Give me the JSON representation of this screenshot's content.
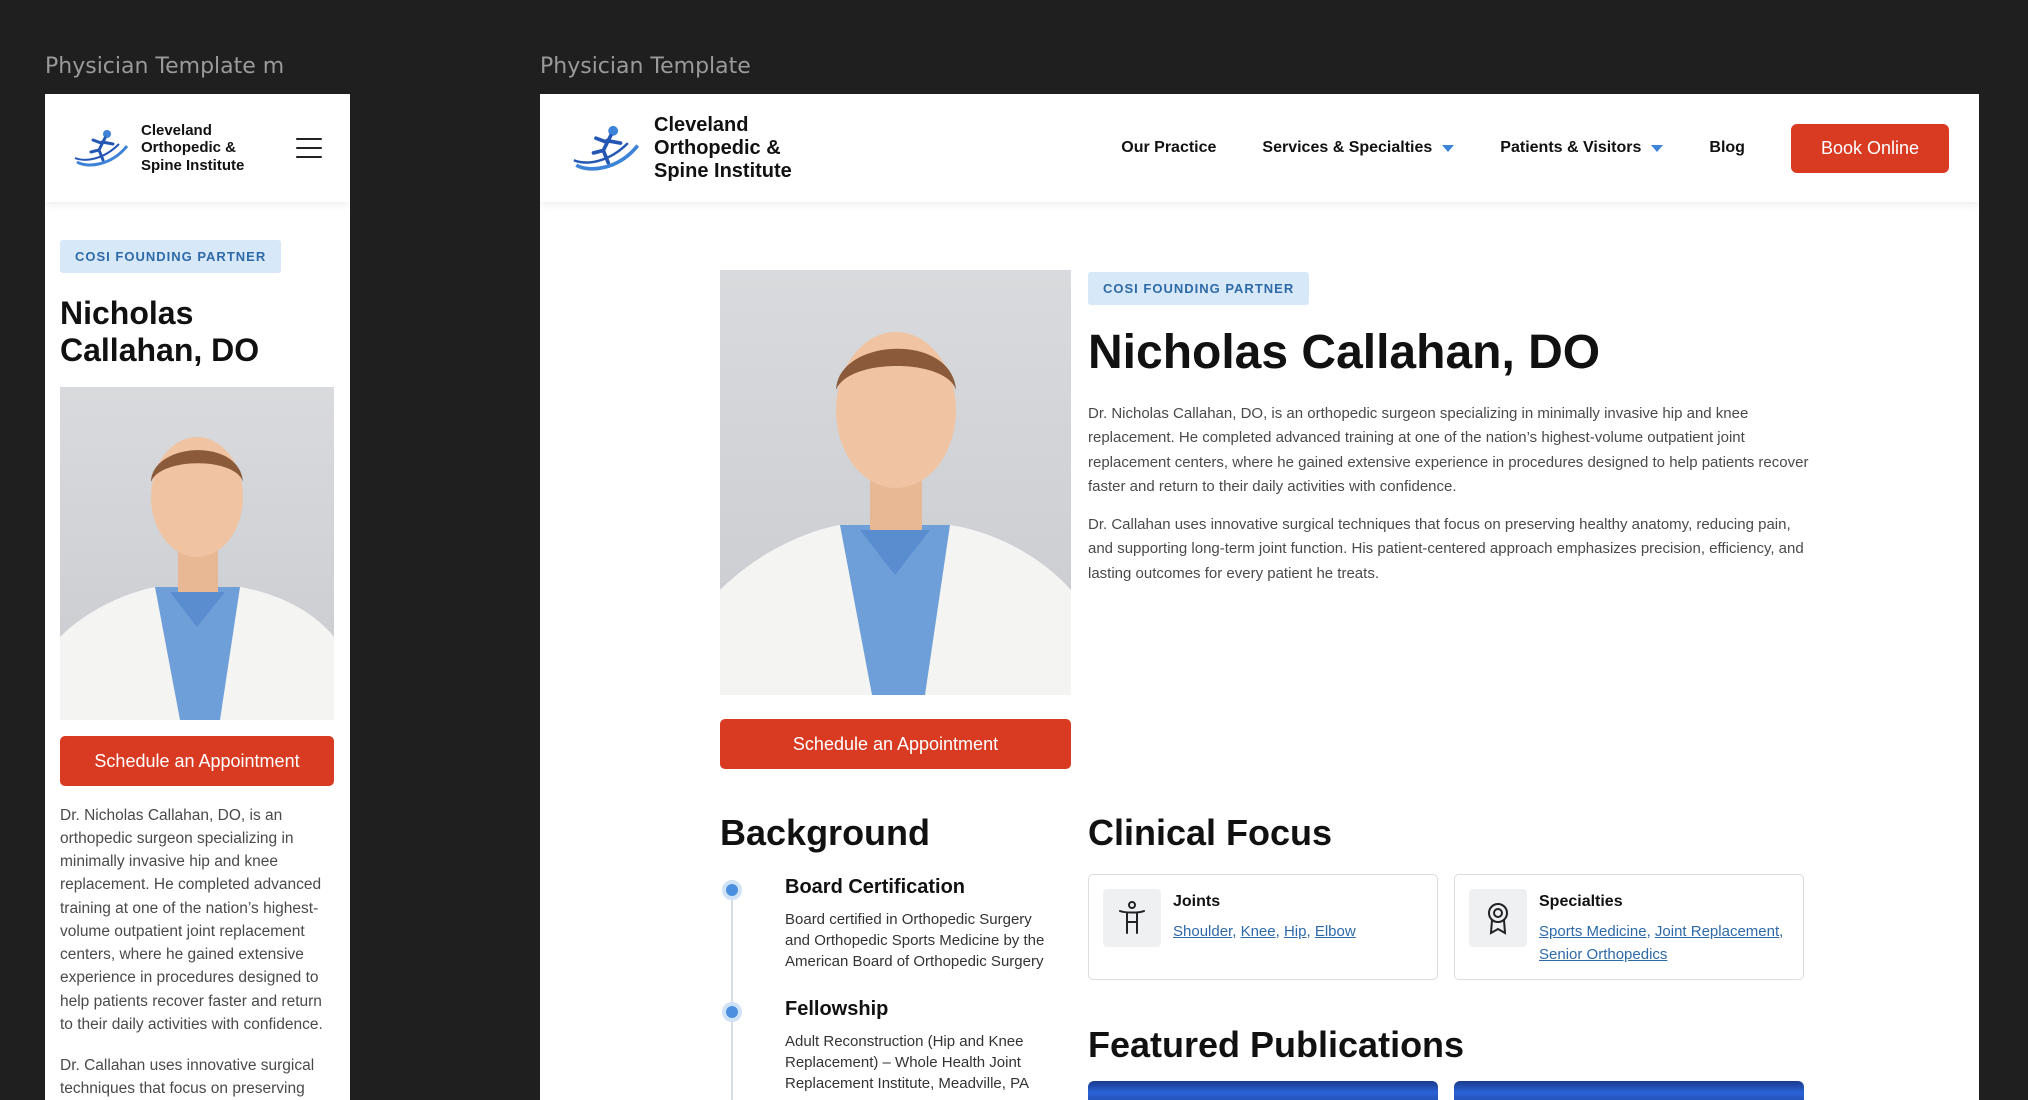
{
  "frames": {
    "mobile_label": "Physician Template m",
    "desktop_label": "Physician Template"
  },
  "brand": {
    "logo_line1": "Cleveland",
    "logo_line2": "Orthopedic &",
    "logo_line3": "Spine Institute",
    "accent_blue": "#3d83d8",
    "accent_red": "#d93a22"
  },
  "nav": {
    "our_practice": "Our Practice",
    "services": "Services & Specialties",
    "patients": "Patients & Visitors",
    "blog": "Blog",
    "book_online": "Book Online"
  },
  "physician": {
    "badge": "COSI FOUNDING PARTNER",
    "name": "Nicholas Callahan, DO",
    "name_line1": "Nicholas",
    "name_line2": "Callahan, DO",
    "schedule_label": "Schedule an Appointment",
    "bio1": "Dr. Nicholas Callahan, DO, is an orthopedic surgeon specializing in minimally invasive hip and knee replacement. He completed advanced training at one of the nation’s highest-volume outpatient joint replacement centers, where he gained extensive experience in procedures designed to help patients recover faster and return to their daily activities with confidence.",
    "bio2": "Dr. Callahan uses innovative surgical techniques that focus on preserving healthy anatomy, reducing pain, and supporting long-term joint function. His patient-centered approach emphasizes precision, efficiency, and lasting outcomes for every patient he treats.",
    "bio2_mobile": "Dr. Callahan uses innovative surgical techniques that focus on preserving healthy anatomy, reducing pain, and"
  },
  "background": {
    "title": "Background",
    "items": [
      {
        "title": "Board Certification",
        "text": "Board certified in Orthopedic Surgery and Orthopedic Sports Medicine by the American Board of Orthopedic Surgery"
      },
      {
        "title": "Fellowship",
        "text": "Adult Reconstruction (Hip and Knee Replacement) – Whole Health Joint Replacement Institute, Meadville, PA"
      }
    ]
  },
  "clinical_focus": {
    "title": "Clinical Focus",
    "joints": {
      "title": "Joints",
      "links": [
        "Shoulder",
        "Knee",
        "Hip",
        "Elbow"
      ]
    },
    "specialties": {
      "title": "Specialties",
      "links": [
        "Sports Medicine",
        "Joint Replacement",
        "Senior Orthopedics"
      ]
    },
    "icons": [
      "person-icon",
      "award-icon"
    ]
  },
  "publications": {
    "title": "Featured Publications"
  }
}
